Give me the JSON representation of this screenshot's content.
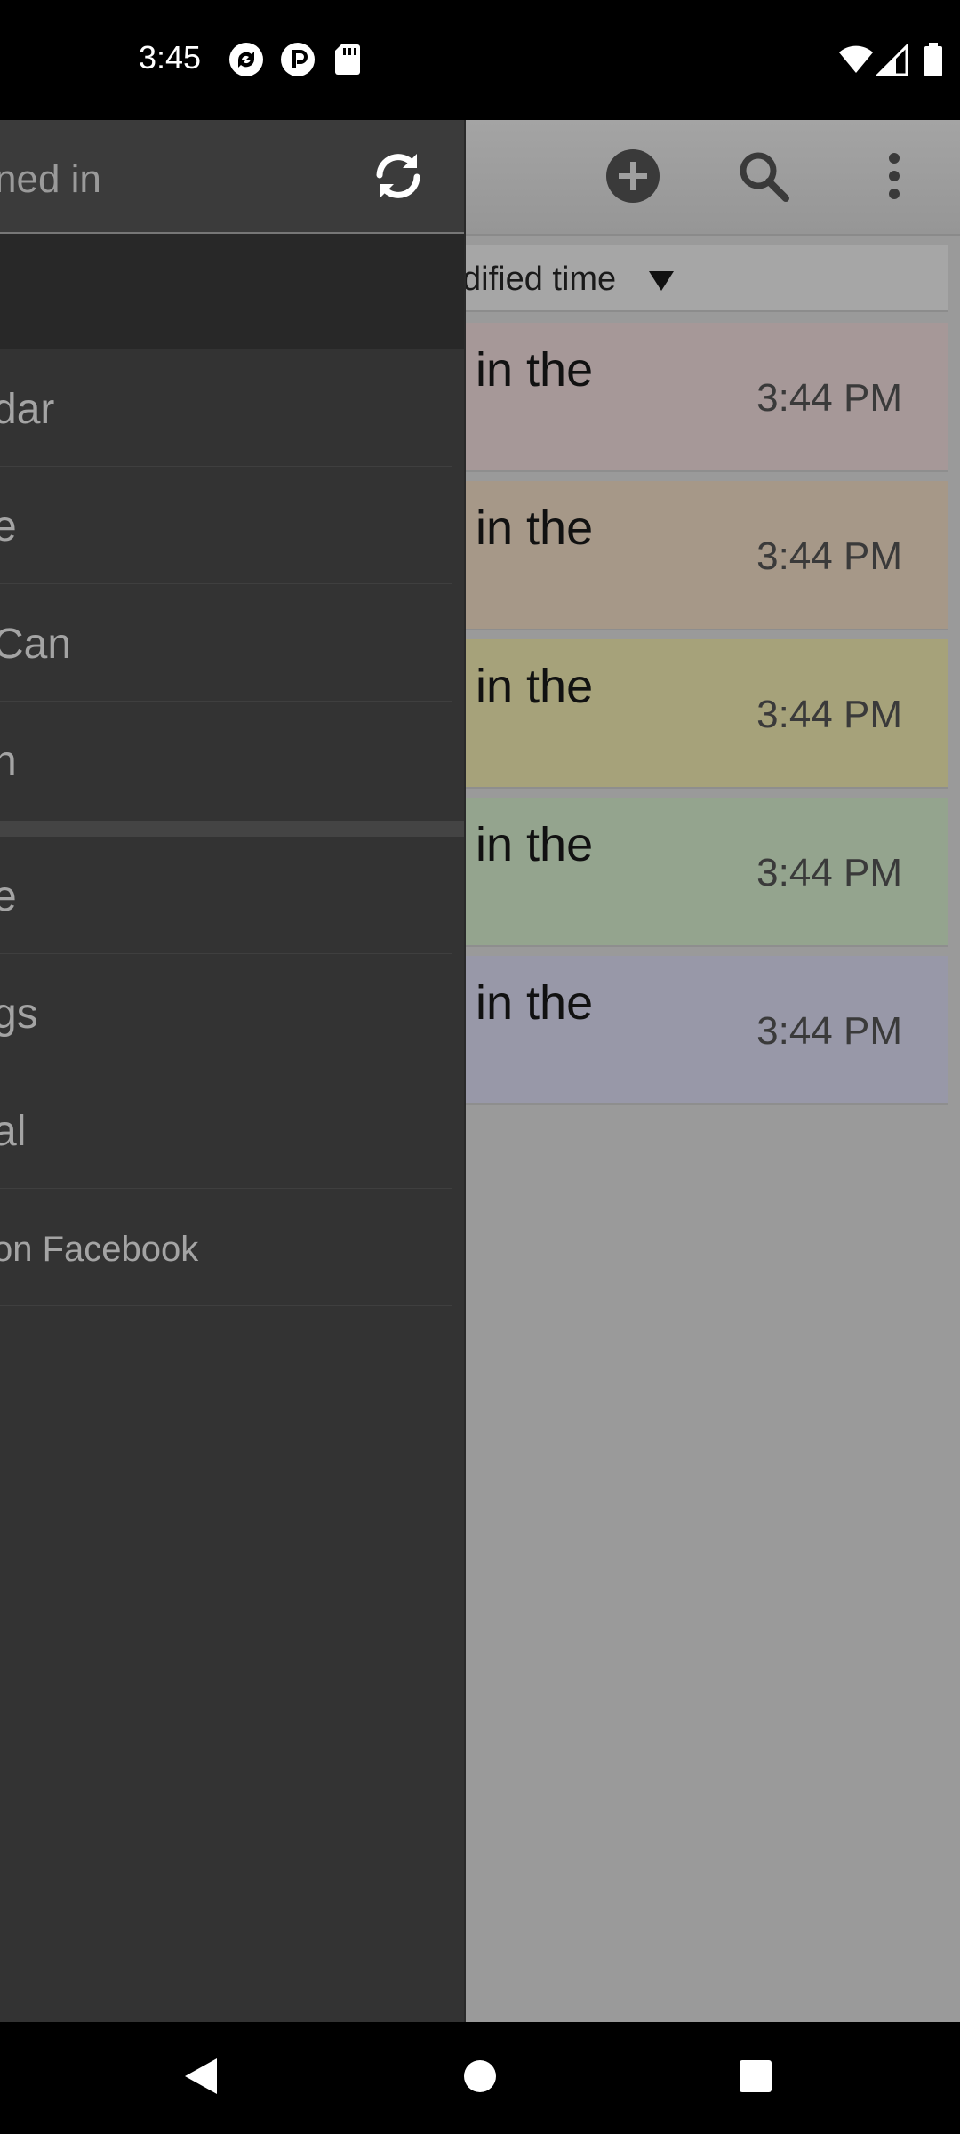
{
  "status_bar": {
    "time": "3:45",
    "icons_left": [
      "sync-app-icon",
      "pinterest-like-icon",
      "sd-card-icon"
    ],
    "icons_right": [
      "wifi-icon",
      "signal-icon",
      "battery-icon"
    ]
  },
  "toolbar": {
    "add_icon": "add-circle-icon",
    "search_icon": "search-icon",
    "more_icon": "more-vert-icon"
  },
  "sort_bar": {
    "label": "dified time",
    "arrow_icon": "sort-descending-icon"
  },
  "notes": [
    {
      "title": "in the",
      "time": "3:44 PM",
      "color": "#a69898"
    },
    {
      "title": "in the",
      "time": "3:44 PM",
      "color": "#a69888"
    },
    {
      "title": "in the",
      "time": "3:44 PM",
      "color": "#a6a27a"
    },
    {
      "title": "in the",
      "time": "3:44 PM",
      "color": "#94a48e"
    },
    {
      "title": "in the",
      "time": "3:44 PM",
      "color": "#9898a8"
    }
  ],
  "drawer": {
    "header_text": "ned in",
    "sync_icon": "sync-icon",
    "items_group1": [
      "dar",
      "e",
      "Can",
      "n"
    ],
    "items_group2": [
      "e",
      "gs",
      "al",
      "on Facebook"
    ]
  },
  "nav_bar": {
    "back_icon": "back-icon",
    "home_icon": "home-icon",
    "recents_icon": "recents-icon"
  }
}
